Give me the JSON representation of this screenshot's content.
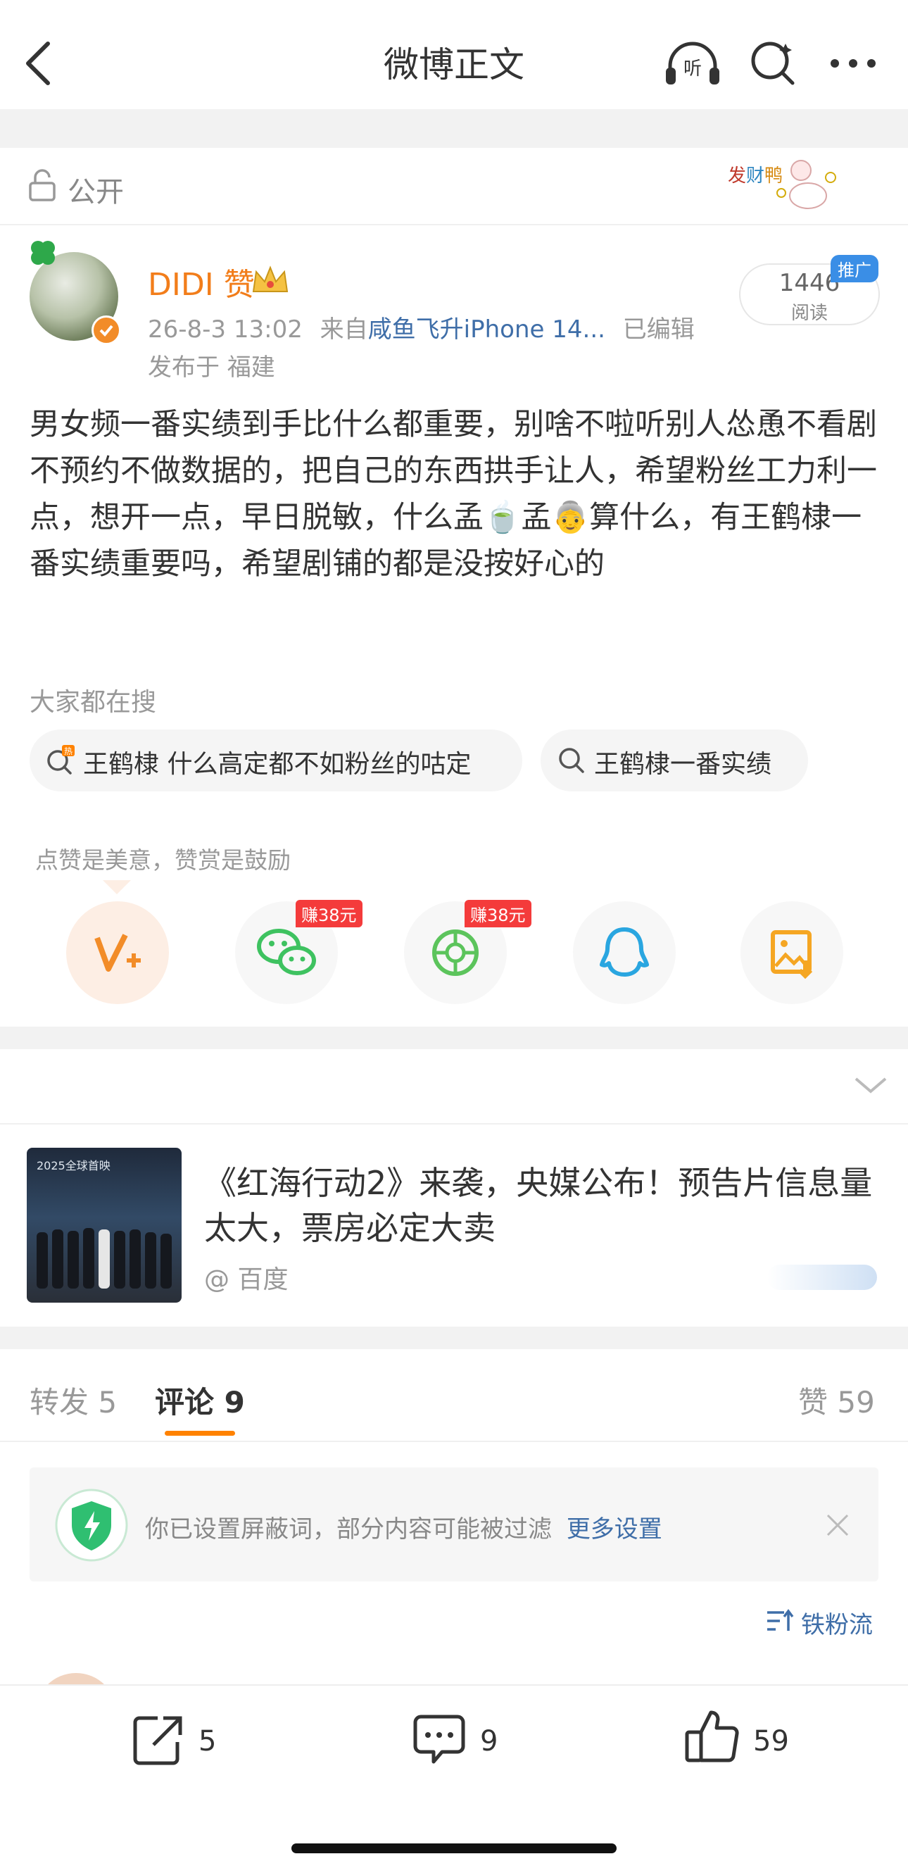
{
  "nav": {
    "title": "微博正文"
  },
  "visibility": {
    "label": "公开"
  },
  "author": {
    "name": "DIDI",
    "name_suffix": "赞",
    "datetime": "26-8-3 13:02",
    "source_prefix": "来自",
    "source": "咸鱼飞升iPhone 14...",
    "edited": "已编辑",
    "location": "发布于 福建",
    "reads": "1446",
    "reads_label": "阅读",
    "promo": "推广"
  },
  "post": {
    "text": "男女频一番实绩到手比什么都重要，别啥不啦听别人怂恿不看剧不预约不做数据的，把自己的东西拱手让人，希望粉丝工力利一点，想开一点，早日脱敏，什么孟🍵孟👵算什么，有王鹤棣一番实绩重要吗，希望剧铺的都是没按好心的"
  },
  "hot_search": {
    "title": "大家都在搜",
    "items": [
      {
        "text": "王鹤棣 什么高定都不如粉丝的咕定"
      },
      {
        "text": "王鹤棣一番实绩"
      }
    ]
  },
  "share": {
    "hint": "点赞是美意，赞赏是鼓励",
    "badge_wechat": "赚38元",
    "badge_moments": "赚38元"
  },
  "ad": {
    "title": "《红海行动2》来袭，央媒公布！预告片信息量太大，票房必定大卖",
    "source": "@ 百度",
    "thumb_text": "2025全球首映"
  },
  "tabs": {
    "repost": "转发 5",
    "comment": "评论 9",
    "like": "赞 59"
  },
  "notice": {
    "text": "你已设置屏蔽词，部分内容可能被过滤",
    "link": "更多设置"
  },
  "sort": {
    "label": "铁粉流"
  },
  "bottom": {
    "repost_count": "5",
    "comment_count": "9",
    "like_count": "59"
  },
  "colors": {
    "accent": "#ff8200",
    "author": "#f27d1a",
    "link": "#3f6ea8",
    "badge_red": "#f43b3b"
  }
}
